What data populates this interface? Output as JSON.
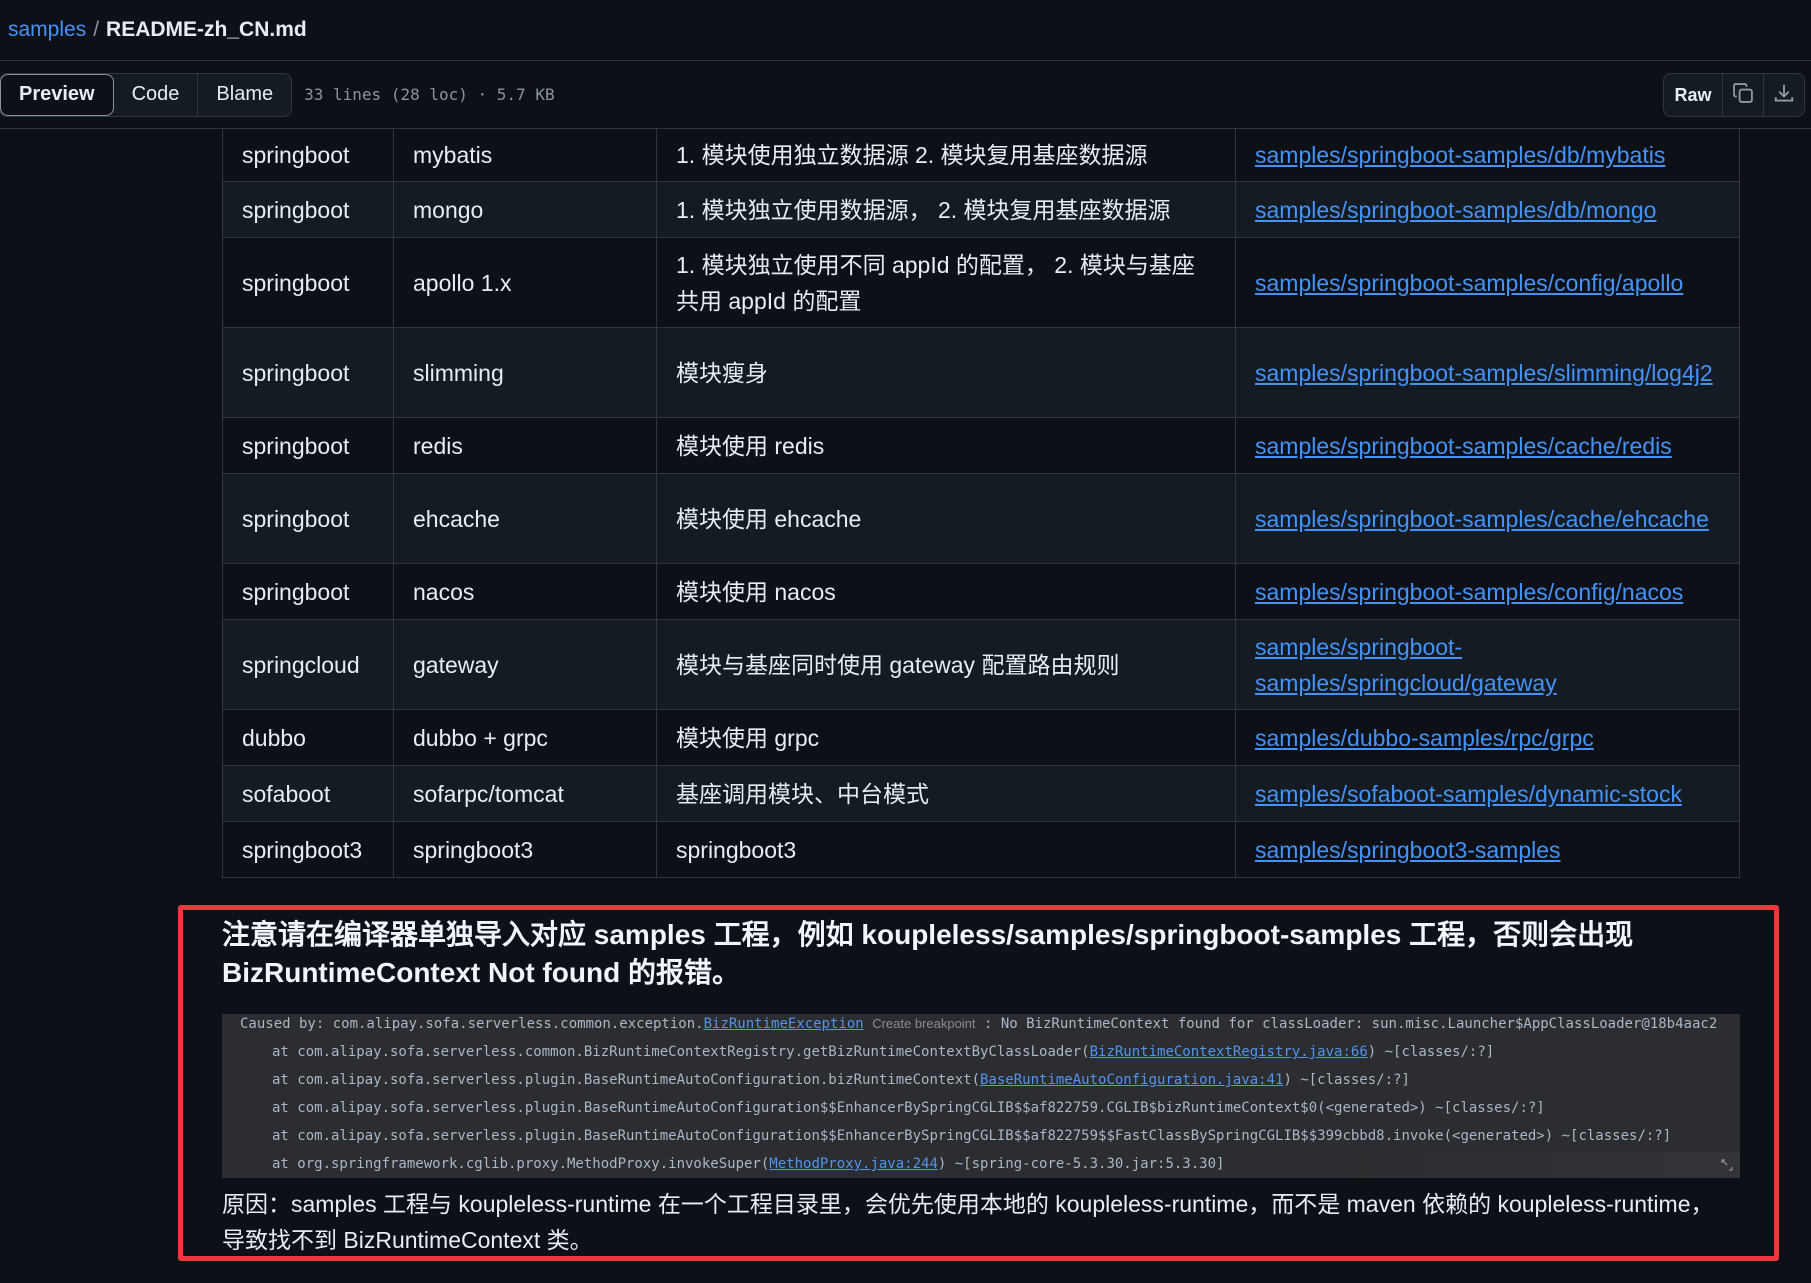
{
  "breadcrumb": {
    "repo": "samples",
    "separator": "/",
    "file": "README-zh_CN.md"
  },
  "toolbar": {
    "tabs": [
      {
        "label": "Preview",
        "active": true
      },
      {
        "label": "Code",
        "active": false
      },
      {
        "label": "Blame",
        "active": false
      }
    ],
    "file_info": "33 lines (28 loc) · 5.7 KB",
    "raw_label": "Raw",
    "icons": [
      "copy-icon",
      "download-icon"
    ]
  },
  "table": {
    "rows": [
      {
        "framework": "springboot",
        "component": "mybatis",
        "description": "1. 模块使用独立数据源 2. 模块复用基座数据源",
        "link": "samples/springboot-samples/db/mybatis"
      },
      {
        "framework": "springboot",
        "component": "mongo",
        "description": "1. 模块独立使用数据源， 2. 模块复用基座数据源",
        "link": "samples/springboot-samples/db/mongo"
      },
      {
        "framework": "springboot",
        "component": "apollo 1.x",
        "description": "1. 模块独立使用不同 appId 的配置， 2. 模块与基座共用 appId 的配置",
        "link": "samples/springboot-samples/config/apollo"
      },
      {
        "framework": "springboot",
        "component": "slimming",
        "description": "模块瘦身",
        "link": "samples/springboot-samples/slimming/log4j2"
      },
      {
        "framework": "springboot",
        "component": "redis",
        "description": "模块使用 redis",
        "link": "samples/springboot-samples/cache/redis"
      },
      {
        "framework": "springboot",
        "component": "ehcache",
        "description": "模块使用 ehcache",
        "link": "samples/springboot-samples/cache/ehcache"
      },
      {
        "framework": "springboot",
        "component": "nacos",
        "description": "模块使用 nacos",
        "link": "samples/springboot-samples/config/nacos"
      },
      {
        "framework": "springcloud",
        "component": "gateway",
        "description": "模块与基座同时使用 gateway 配置路由规则",
        "link": "samples/springboot-samples/springcloud/gateway"
      },
      {
        "framework": "dubbo",
        "component": "dubbo + grpc",
        "description": "模块使用 grpc",
        "link": "samples/dubbo-samples/rpc/grpc"
      },
      {
        "framework": "sofaboot",
        "component": "sofarpc/tomcat",
        "description": "基座调用模块、中台模式",
        "link": "samples/sofaboot-samples/dynamic-stock"
      },
      {
        "framework": "springboot3",
        "component": "springboot3",
        "description": "springboot3",
        "link": "samples/springboot3-samples"
      }
    ]
  },
  "notice": {
    "title": "注意请在编译器单独导入对应 samples 工程，例如 koupleless/samples/springboot-samples 工程，否则会出现 BizRuntimeContext Not found 的报错。",
    "stack": {
      "l0_pre": "Caused by: com.alipay.sofa.serverless.common.exception.",
      "l0_link": "BizRuntimeException",
      "l0_hint": "Create breakpoint",
      "l0_post": " : No BizRuntimeContext found for classLoader: sun.misc.Launcher$AppClassLoader@18b4aac2",
      "l1_pre": "at com.alipay.sofa.serverless.common.BizRuntimeContextRegistry.getBizRuntimeContextByClassLoader(",
      "l1_link": "BizRuntimeContextRegistry.java:66",
      "l1_post": ") ~[classes/:?]",
      "l2_pre": "at com.alipay.sofa.serverless.plugin.BaseRuntimeAutoConfiguration.bizRuntimeContext(",
      "l2_link": "BaseRuntimeAutoConfiguration.java:41",
      "l2_post": ") ~[classes/:?]",
      "l3": "at com.alipay.sofa.serverless.plugin.BaseRuntimeAutoConfiguration$$EnhancerBySpringCGLIB$$af822759.CGLIB$bizRuntimeContext$0(<generated>) ~[classes/:?]",
      "l4": "at com.alipay.sofa.serverless.plugin.BaseRuntimeAutoConfiguration$$EnhancerBySpringCGLIB$$af822759$$FastClassBySpringCGLIB$$399cbbd8.invoke(<generated>) ~[classes/:?]",
      "l5_pre": "at org.springframework.cglib.proxy.MethodProxy.invokeSuper(",
      "l5_link": "MethodProxy.java:244",
      "l5_post": ") ~[spring-core-5.3.30.jar:5.3.30]"
    },
    "reason": "原因：samples 工程与 koupleless-runtime 在一个工程目录里，会优先使用本地的 koupleless-runtime，而不是 maven 依赖的 koupleless-runtime，导致找不到 BizRuntimeContext 类。"
  },
  "colors": {
    "accent": "#4493f8",
    "highlight_border": "#f0373f",
    "background": "#0d1117"
  }
}
